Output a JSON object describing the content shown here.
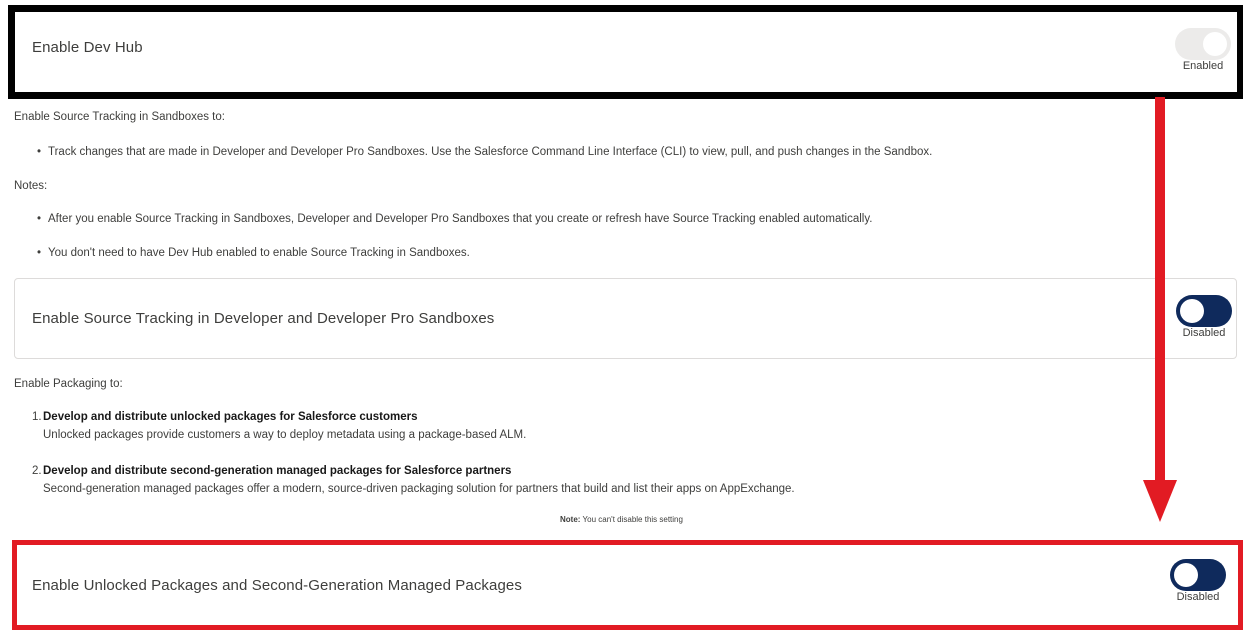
{
  "devhub": {
    "title": "Enable Dev Hub",
    "status": "Enabled"
  },
  "source_tracking": {
    "intro": "Enable Source Tracking in Sandboxes to:",
    "bullets": [
      "Track changes that are made in Developer and Developer Pro Sandboxes. Use the Salesforce Command Line Interface (CLI) to view, pull, and push changes in the Sandbox."
    ],
    "notes_label": "Notes:",
    "notes": [
      "After you enable Source Tracking in Sandboxes, Developer and Developer Pro Sandboxes that you create or refresh have Source Tracking enabled automatically.",
      "You don't need to have Dev Hub enabled to enable Source Tracking in Sandboxes."
    ],
    "card_title": "Enable Source Tracking in Developer and Developer Pro Sandboxes",
    "status": "Disabled"
  },
  "packaging": {
    "intro": "Enable Packaging to:",
    "items": [
      {
        "num": "1.",
        "heading": "Develop and distribute unlocked packages for Salesforce customers",
        "desc": "Unlocked packages provide customers a way to deploy metadata using a package-based ALM."
      },
      {
        "num": "2.",
        "heading": "Develop and distribute second-generation managed packages for Salesforce partners",
        "desc": "Second-generation managed packages offer a modern, source-driven packaging solution for partners that build and list their apps on AppExchange."
      }
    ],
    "note_label": "Note:",
    "note_text": "You can't disable this setting",
    "card_title": "Enable Unlocked Packages and Second-Generation Managed Packages",
    "status": "Disabled"
  },
  "colors": {
    "highlight_black": "#000000",
    "highlight_red": "#e21b23",
    "toggle_off": "#0f2a5c",
    "toggle_on_disabled": "#ecebea"
  },
  "icons": {
    "arrow": "down-arrow-icon"
  }
}
